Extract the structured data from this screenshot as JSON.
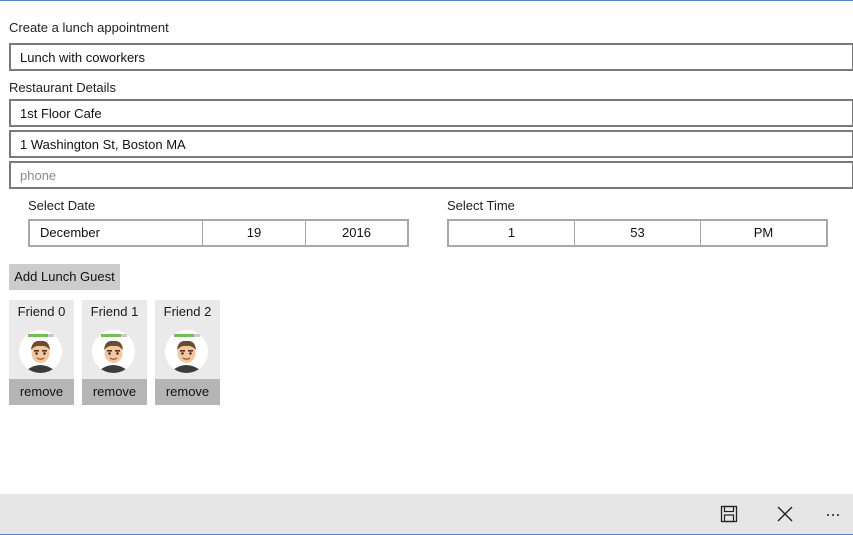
{
  "form": {
    "header": "Create a lunch appointment",
    "subject_value": "Lunch with coworkers",
    "restaurant_section_label": "Restaurant Details",
    "restaurant_name_value": "1st Floor Cafe",
    "address_value": "1 Washington St, Boston MA",
    "phone_placeholder": "phone"
  },
  "date_picker": {
    "label": "Select Date",
    "month": "December",
    "day": "19",
    "year": "2016"
  },
  "time_picker": {
    "label": "Select Time",
    "hour": "1",
    "minute": "53",
    "period": "PM"
  },
  "guests": {
    "add_button_label": "Add Lunch Guest",
    "items": [
      {
        "name": "Friend 0",
        "remove_label": "remove"
      },
      {
        "name": "Friend 1",
        "remove_label": "remove"
      },
      {
        "name": "Friend 2",
        "remove_label": "remove"
      }
    ]
  },
  "app_bar": {
    "icons": [
      "save-icon",
      "cancel-icon",
      "more-icon"
    ]
  }
}
